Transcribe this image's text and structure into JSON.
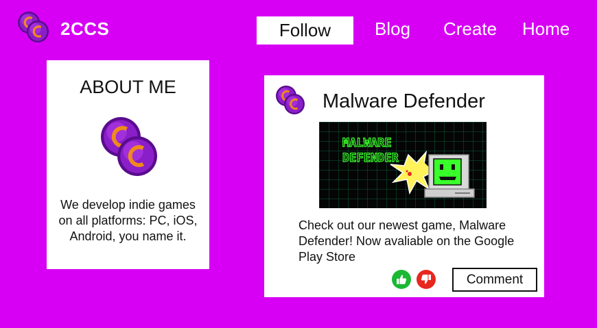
{
  "header": {
    "brand": "2CCS",
    "nav": {
      "follow": "Follow",
      "blog": "Blog",
      "create": "Create",
      "home": "Home"
    }
  },
  "about": {
    "title": "ABOUT ME",
    "text": "We develop indie games on all platforms: PC, iOS, Android, you name it."
  },
  "post": {
    "title": "Malware Defender",
    "image_lines": [
      "MALWARE",
      "DEFENDER"
    ],
    "text": "Check out our newest game, Malware Defender! Now avaliable on the Google Play Store",
    "comment_label": "Comment"
  },
  "colors": {
    "background": "#D700F5",
    "like": "#1BB833",
    "dislike": "#E8271E",
    "coin_purple": "#8A1FC9",
    "coin_orange": "#F08A1C"
  },
  "icons": {
    "logo": "coin-stack-icon",
    "like": "thumbs-up-icon",
    "dislike": "thumbs-down-icon"
  }
}
